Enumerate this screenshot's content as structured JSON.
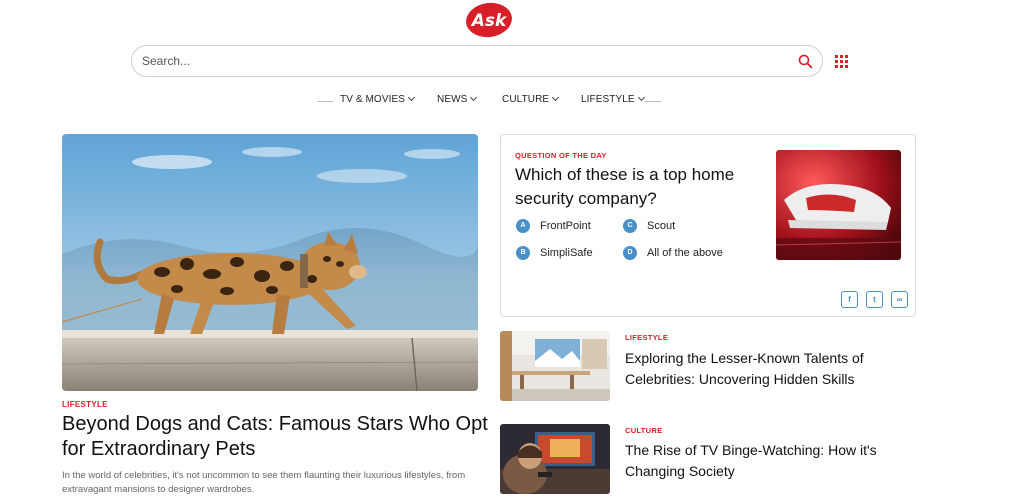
{
  "header": {
    "logo_text": "Ask",
    "search_placeholder": "Search...",
    "brand_color": "#d81e27"
  },
  "nav": {
    "items": [
      {
        "label": "TV & MOVIES"
      },
      {
        "label": "NEWS"
      },
      {
        "label": "CULTURE"
      },
      {
        "label": "LIFESTYLE"
      }
    ]
  },
  "hero": {
    "category": "LIFESTYLE",
    "title": "Beyond Dogs and Cats: Famous Stars Who Opt for Extraordinary Pets",
    "description": "In the world of celebrities, it's not uncommon to see them flaunting their luxurious lifestyles, from extravagant mansions to designer wardrobes."
  },
  "qotd": {
    "label": "QUESTION OF THE DAY",
    "question": "Which of these is a top home security company?",
    "answers": [
      {
        "letter": "A",
        "text": "FrontPoint"
      },
      {
        "letter": "C",
        "text": "Scout"
      },
      {
        "letter": "B",
        "text": "SimpliSafe"
      },
      {
        "letter": "D",
        "text": "All of the above"
      }
    ],
    "share": {
      "facebook": "f",
      "twitter": "t",
      "link": "∞"
    }
  },
  "side_articles": [
    {
      "category": "LIFESTYLE",
      "title": "Exploring the Lesser-Known Talents of Celebrities: Uncovering Hidden Skills"
    },
    {
      "category": "CULTURE",
      "title": "The Rise of TV Binge-Watching: How it's Changing Society"
    }
  ],
  "icons": {
    "search": "search-icon",
    "apps": "apps-grid-icon",
    "chevron": "chevron-down-icon"
  }
}
